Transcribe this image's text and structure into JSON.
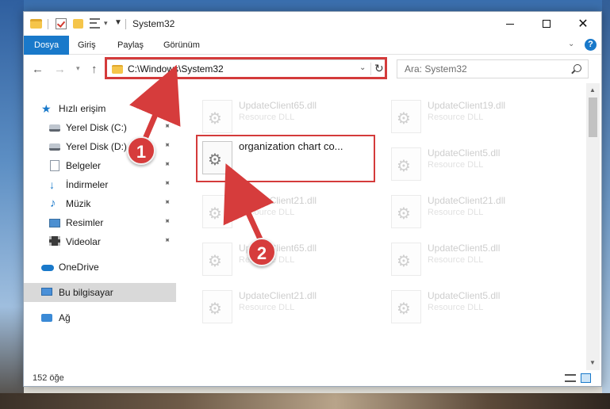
{
  "window": {
    "title": "System32",
    "controls": {
      "minimize": "—",
      "maximize": "□",
      "close": "✕"
    }
  },
  "ribbon": {
    "tabs": [
      {
        "label": "Dosya"
      },
      {
        "label": "Giriş"
      },
      {
        "label": "Paylaş"
      },
      {
        "label": "Görünüm"
      }
    ],
    "help": "?"
  },
  "address": {
    "path": "C:\\Windows\\System32",
    "search_placeholder": "Ara: System32"
  },
  "sidebar": {
    "items": [
      {
        "label": "Hızlı erişim",
        "icon": "star-icon"
      },
      {
        "label": "Yerel Disk (C:)",
        "icon": "drive-icon"
      },
      {
        "label": "Yerel Disk (D:)",
        "icon": "drive-icon"
      },
      {
        "label": "Belgeler",
        "icon": "documents-icon"
      },
      {
        "label": "İndirmeler",
        "icon": "downloads-icon"
      },
      {
        "label": "Müzik",
        "icon": "music-icon"
      },
      {
        "label": "Resimler",
        "icon": "pictures-icon"
      },
      {
        "label": "Videolar",
        "icon": "videos-icon"
      },
      {
        "label": "OneDrive",
        "icon": "cloud-icon"
      },
      {
        "label": "Bu bilgisayar",
        "icon": "computer-icon"
      },
      {
        "label": "Ağ",
        "icon": "network-icon"
      }
    ]
  },
  "files": [
    {
      "name": "UpdateClient65.dll",
      "type": "Resource DLL"
    },
    {
      "name": "UpdateClient19.dll",
      "type": "Resource DLL"
    },
    {
      "name": "organization chart co...",
      "type": ""
    },
    {
      "name": "UpdateClient5.dll",
      "type": "Resource DLL"
    },
    {
      "name": "UpdateClient21.dll",
      "type": "Resource DLL"
    },
    {
      "name": "UpdateClient21.dll",
      "type": "Resource DLL"
    },
    {
      "name": "UpdateClient65.dll",
      "type": "Resource DLL"
    },
    {
      "name": "UpdateClient5.dll",
      "type": "Resource DLL"
    },
    {
      "name": "UpdateClient21.dll",
      "type": "Resource DLL"
    },
    {
      "name": "UpdateClient5.dll",
      "type": "Resource DLL"
    }
  ],
  "status": {
    "item_count": "152 öğe"
  },
  "annotations": {
    "step1": "1",
    "step2": "2",
    "color": "#d63c3c"
  },
  "colors": {
    "accent": "#1979ca",
    "highlight": "#d43b3b"
  }
}
